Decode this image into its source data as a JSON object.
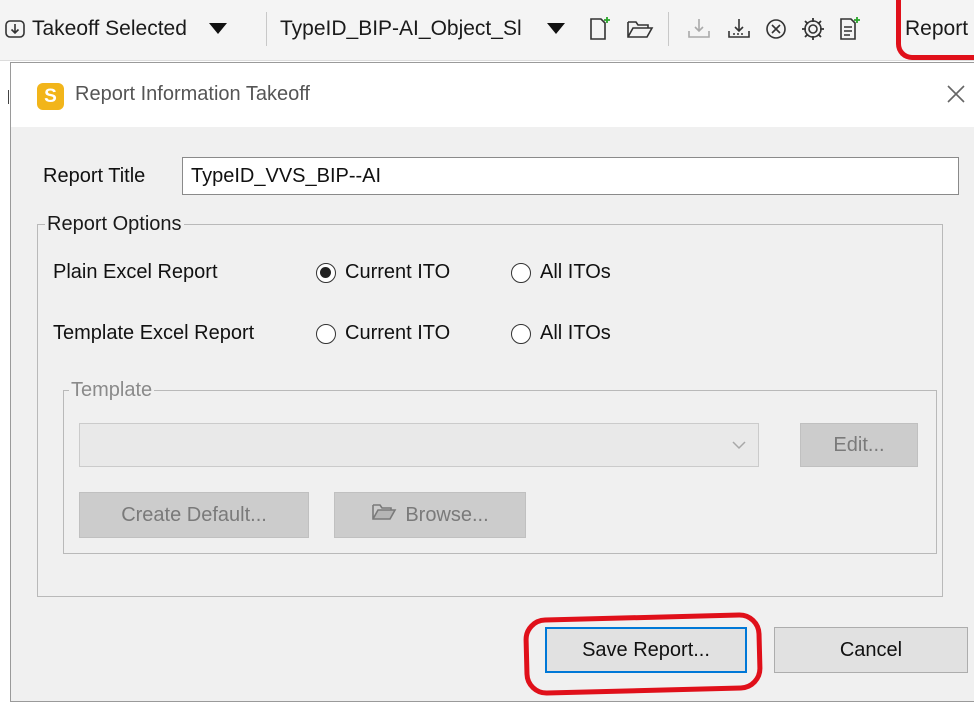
{
  "toolbar": {
    "takeoff_label": "Takeoff Selected",
    "type_selector_label": "TypeID_BIP-AI_Object_Sl",
    "report_label": "Report"
  },
  "dialog": {
    "title": "Report Information Takeoff",
    "logo_letter": "S",
    "report_title_label": "Report Title",
    "report_title_value": "TypeID_VVS_BIP--AI",
    "report_options_legend": "Report Options",
    "plain_excel_label": "Plain Excel Report",
    "template_excel_label": "Template Excel Report",
    "current_ito": "Current ITO",
    "all_itos": "All ITOs",
    "template_legend": "Template",
    "edit_label": "Edit...",
    "create_default_label": "Create Default...",
    "browse_label": "Browse...",
    "save_report_label": "Save Report...",
    "cancel_label": "Cancel",
    "selected_option": "plain-current-ito"
  },
  "colors": {
    "annotation_red": "#e0101a",
    "logo_yellow": "#f2b51a",
    "focus_blue": "#0078d7"
  }
}
